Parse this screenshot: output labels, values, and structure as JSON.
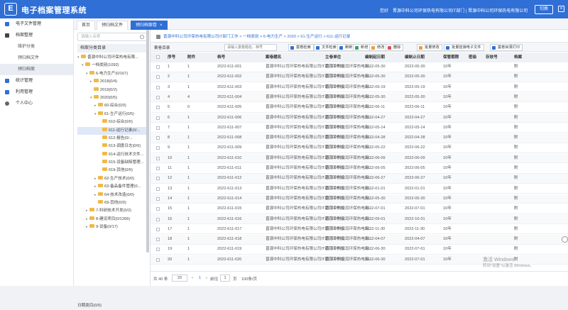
{
  "app": {
    "logo_char": "E",
    "title": "电子档案管理系统"
  },
  "header": {
    "greeting": "您好",
    "user": "晋源中科公司环保热电有限公司IT部门 | 晋源中科公司环保热电有限公司",
    "switch_label": "切换",
    "close_glyph": "×"
  },
  "nav": {
    "items": [
      {
        "label": "电子文件管理",
        "icon": "file-icon",
        "active": false,
        "sub": false
      },
      {
        "label": "档案整理",
        "icon": "edit-icon",
        "active": false,
        "sub": false
      },
      {
        "label": "维护分类",
        "icon": "",
        "active": false,
        "sub": true
      },
      {
        "label": "预归档文件",
        "icon": "",
        "active": false,
        "sub": true
      },
      {
        "label": "预归档案",
        "icon": "",
        "active": true,
        "sub": true
      },
      {
        "label": "统计管理",
        "icon": "chart-icon",
        "active": false,
        "sub": false
      },
      {
        "label": "利用管理",
        "icon": "grid-icon",
        "active": false,
        "sub": false
      },
      {
        "label": "个人中心",
        "icon": "user-icon",
        "active": false,
        "sub": false
      }
    ]
  },
  "tabs": [
    {
      "label": "首页",
      "active": false
    },
    {
      "label": "预归档文件",
      "active": false
    },
    {
      "label": "预归档案卷",
      "active": true,
      "close": "×"
    }
  ],
  "tree": {
    "search_placeholder": "请输入名称",
    "header": "档案分类目录",
    "nodes": [
      {
        "label": "晋源中科公司环保热电有限...",
        "level": 0,
        "arrow": "▾",
        "selected": false
      },
      {
        "label": "一档类别(1092)",
        "level": 1,
        "arrow": "▾",
        "selected": false
      },
      {
        "label": "6-电力生产(0/167)",
        "level": 2,
        "arrow": "▾",
        "selected": false
      },
      {
        "label": "2018(0/4)",
        "level": 3,
        "arrow": "▸",
        "selected": false
      },
      {
        "label": "2019(0/2)",
        "level": 3,
        "arrow": "",
        "selected": false
      },
      {
        "label": "2020(0/5)",
        "level": 3,
        "arrow": "▾",
        "selected": false
      },
      {
        "label": "60-综合(0/0)",
        "level": 4,
        "arrow": "▸",
        "selected": false
      },
      {
        "label": "61-生产运行(0/5)",
        "level": 4,
        "arrow": "▾",
        "selected": false
      },
      {
        "label": "610-综合(0/0)",
        "level": 5,
        "arrow": "",
        "selected": false
      },
      {
        "label": "611-运行记录(0/...",
        "level": 5,
        "arrow": "",
        "selected": true
      },
      {
        "label": "612-报告(0/...",
        "level": 5,
        "arrow": "",
        "selected": false
      },
      {
        "label": "613-调度日志(0/0)",
        "level": 5,
        "arrow": "",
        "selected": false
      },
      {
        "label": "614-运行技术文件...",
        "level": 5,
        "arrow": "",
        "selected": false
      },
      {
        "label": "615-设备缺陷管理...",
        "level": 5,
        "arrow": "",
        "selected": false
      },
      {
        "label": "619-其他(0/0)",
        "level": 5,
        "arrow": "",
        "selected": false
      },
      {
        "label": "62-生产技术(0/0)",
        "level": 4,
        "arrow": "▸",
        "selected": false
      },
      {
        "label": "63-备品备件管理(0...",
        "level": 4,
        "arrow": "▸",
        "selected": false
      },
      {
        "label": "64-技术改造(0/0)",
        "level": 4,
        "arrow": "▸",
        "selected": false
      },
      {
        "label": "69-其他(0/0)",
        "level": 4,
        "arrow": "",
        "selected": false
      },
      {
        "label": "7-科研技术开发(0/2)",
        "level": 2,
        "arrow": "▸",
        "selected": false
      },
      {
        "label": "8-建设项目(0/1266)",
        "level": 2,
        "arrow": "▸",
        "selected": false
      },
      {
        "label": "9-设备(0/17)",
        "level": 2,
        "arrow": "▸",
        "selected": false
      }
    ],
    "footer": "日期类目(0/0)"
  },
  "breadcrumb": "晋源中科公司环保热电有限公司IT部门工作 > 一档类别 > 6-电力生产 > 2020 > 61-生产运行 > 611-运行记录",
  "toolbar": {
    "title": "案卷目录",
    "search_placeholder": "请输入案卷题名、档号",
    "buttons": [
      {
        "label": "案卷检索",
        "color": "#2f6fd6"
      },
      {
        "label": "文件检索",
        "color": "#2f6fd6"
      },
      {
        "label": "刷新",
        "color": "#2f6fd6"
      },
      {
        "label": "新增",
        "color": "#3aa655"
      },
      {
        "label": "修改",
        "color": "#e6a23c"
      },
      {
        "label": "删除",
        "color": "#e05050"
      },
      {
        "label": "批量修改",
        "color": "#e6a23c"
      },
      {
        "label": "批量挂接电子文件",
        "color": "#2f6fd6"
      },
      {
        "label": "案卷目录打印",
        "color": "#2f6fd6"
      }
    ]
  },
  "table": {
    "columns": [
      "",
      "序号",
      "附件",
      "档号",
      "案卷题名",
      "立卷单位",
      "编制起日期",
      "编制止日期",
      "保管期限",
      "密级",
      "存放号",
      "档案"
    ],
    "rows": [
      {
        "no": "1",
        "att": "1",
        "id": "2022-611-001",
        "title": "晋源中科公司环保热电有限公司IT部门工作报...",
        "unit": "晋源中科公司环保热电有...",
        "start": "2022-05-30",
        "end": "2022-05-30",
        "term": "10年",
        "d": "附"
      },
      {
        "no": "2",
        "att": "1",
        "id": "2022-611-002",
        "title": "晋源中科公司环保热电有限公司IT部门工作报...",
        "unit": "晋源中科公司环保热电有...",
        "start": "2022-05-30",
        "end": "2022-05-30",
        "term": "10年",
        "d": "附"
      },
      {
        "no": "3",
        "att": "1",
        "id": "2022-611-003",
        "title": "晋源中科公司环保热电有限公司IT部门工作报...",
        "unit": "晋源中科公司环保热电有...",
        "start": "2022-05-19",
        "end": "2022-05-19",
        "term": "10年",
        "d": "附"
      },
      {
        "no": "4",
        "att": "4",
        "id": "2022-611-004",
        "title": "晋源中科公司环保热电有限公司IT部门工作报...",
        "unit": "晋源中科公司环保热电有...",
        "start": "2022-05-30",
        "end": "2022-05-30",
        "term": "10年",
        "d": "附"
      },
      {
        "no": "5",
        "att": "0",
        "id": "2022-611-005",
        "title": "晋源中科公司环保热电有限公司IT部门工作报...",
        "unit": "晋源中科公司环保热电有...",
        "start": "2022-06-11",
        "end": "2022-06-11",
        "term": "10年",
        "d": "附"
      },
      {
        "no": "6",
        "att": "1",
        "id": "2022-611-006",
        "title": "晋源中科公司环保热电有限公司IT部门工作报...",
        "unit": "晋源中科公司环保热电有...",
        "start": "2022-04-27",
        "end": "2022-04-27",
        "term": "10年",
        "d": "附"
      },
      {
        "no": "7",
        "att": "1",
        "id": "2022-611-007",
        "title": "晋源中科公司环保热电有限公司IT部门工作报...",
        "unit": "晋源中科公司环保热电有...",
        "start": "2022-05-14",
        "end": "2022-05-14",
        "term": "10年",
        "d": "附"
      },
      {
        "no": "8",
        "att": "1",
        "id": "2022-611-008",
        "title": "晋源中科公司环保热电有限公司IT部门工作报...",
        "unit": "晋源中科公司环保热电有...",
        "start": "2022-04-28",
        "end": "2022-04-28",
        "term": "10年",
        "d": "附"
      },
      {
        "no": "9",
        "att": "1",
        "id": "2022-611-009",
        "title": "晋源中科公司环保热电有限公司IT部门工作报...",
        "unit": "晋源中科公司环保热电有...",
        "start": "2022-05-22",
        "end": "2022-06-22",
        "term": "10年",
        "d": "附"
      },
      {
        "no": "10",
        "att": "1",
        "id": "2022-611-010",
        "title": "晋源中科公司环保热电有限公司IT部门工作报...",
        "unit": "晋源中科公司环保热电有...",
        "start": "2022-06-09",
        "end": "2022-06-09",
        "term": "10年",
        "d": "附"
      },
      {
        "no": "11",
        "att": "1",
        "id": "2022-611-011",
        "title": "晋源中科公司环保热电有限公司IT部门工作报...",
        "unit": "晋源中科公司环保热电有...",
        "start": "2022-06-05",
        "end": "2022-06-05",
        "term": "10年",
        "d": "附"
      },
      {
        "no": "12",
        "att": "1",
        "id": "2022-611-012",
        "title": "晋源中科公司环保热电有限公司IT部门工作报...",
        "unit": "晋源中科公司环保热电有...",
        "start": "2022-06-27",
        "end": "2022-06-27",
        "term": "10年",
        "d": "附"
      },
      {
        "no": "13",
        "att": "1",
        "id": "2022-611-013",
        "title": "晋源中科公司环保热电有限公司IT部门工作报...",
        "unit": "晋源中科公司环保热电有...",
        "start": "2022-01-01",
        "end": "2022-01-01",
        "term": "10年",
        "d": "附"
      },
      {
        "no": "14",
        "att": "1",
        "id": "2022-611-014",
        "title": "晋源中科公司环保热电有限公司IT部门工作报...",
        "unit": "晋源中科公司环保热电有...",
        "start": "2022-05-30",
        "end": "2022-05-30",
        "term": "10年",
        "d": "附"
      },
      {
        "no": "15",
        "att": "1",
        "id": "2022-611-015",
        "title": "晋源中科公司环保热电有限公司IT部门工作报...",
        "unit": "晋源中科公司环保热电有...",
        "start": "2022-07-01",
        "end": "2022-07-01",
        "term": "10年",
        "d": "附"
      },
      {
        "no": "16",
        "att": "1",
        "id": "2022-611-016",
        "title": "晋源中科公司环保热电有限公司IT部门工作报...",
        "unit": "晋源中科公司环保热电有...",
        "start": "2022-09-01",
        "end": "2022-10-31",
        "term": "10年",
        "d": "附"
      },
      {
        "no": "17",
        "att": "1",
        "id": "2022-611-017",
        "title": "晋源中科公司环保热电有限公司IT部门工作报...",
        "unit": "晋源中科公司环保热电有...",
        "start": "2022-11-30",
        "end": "2022-11-30",
        "term": "10年",
        "d": "附"
      },
      {
        "no": "18",
        "att": "1",
        "id": "2022-611-018",
        "title": "晋源中科公司环保热电有限公司IT部门工作报...",
        "unit": "晋源中科公司环保热电有...",
        "start": "2022-04-07",
        "end": "2022-04-07",
        "term": "10年",
        "d": "附"
      },
      {
        "no": "19",
        "att": "1",
        "id": "2022-611-019",
        "title": "晋源中科公司环保热电有限公司IT部门工作报...",
        "unit": "晋源中科公司环保热电有...",
        "start": "2022-06-30",
        "end": "2022-07-01",
        "term": "10年",
        "d": "附"
      },
      {
        "no": "20",
        "att": "1",
        "id": "2022-611-020",
        "title": "晋源中科公司环保热电有限公司IT部门工作报...",
        "unit": "晋源中科公司环保热电有...",
        "start": "2022-06-30",
        "end": "2022-07-01",
        "term": "10年",
        "d": "附"
      }
    ]
  },
  "pagination": {
    "total": "共 40 条",
    "page_size": "20",
    "prev": "‹",
    "page": "1",
    "next": "›",
    "goto": "前往",
    "goto_page": "1",
    "page_unit": "页",
    "per_page": "100条/页"
  },
  "watermark": {
    "line1": "激活 Windows",
    "line2": "转到\"设置\"以激活 Windows。"
  }
}
